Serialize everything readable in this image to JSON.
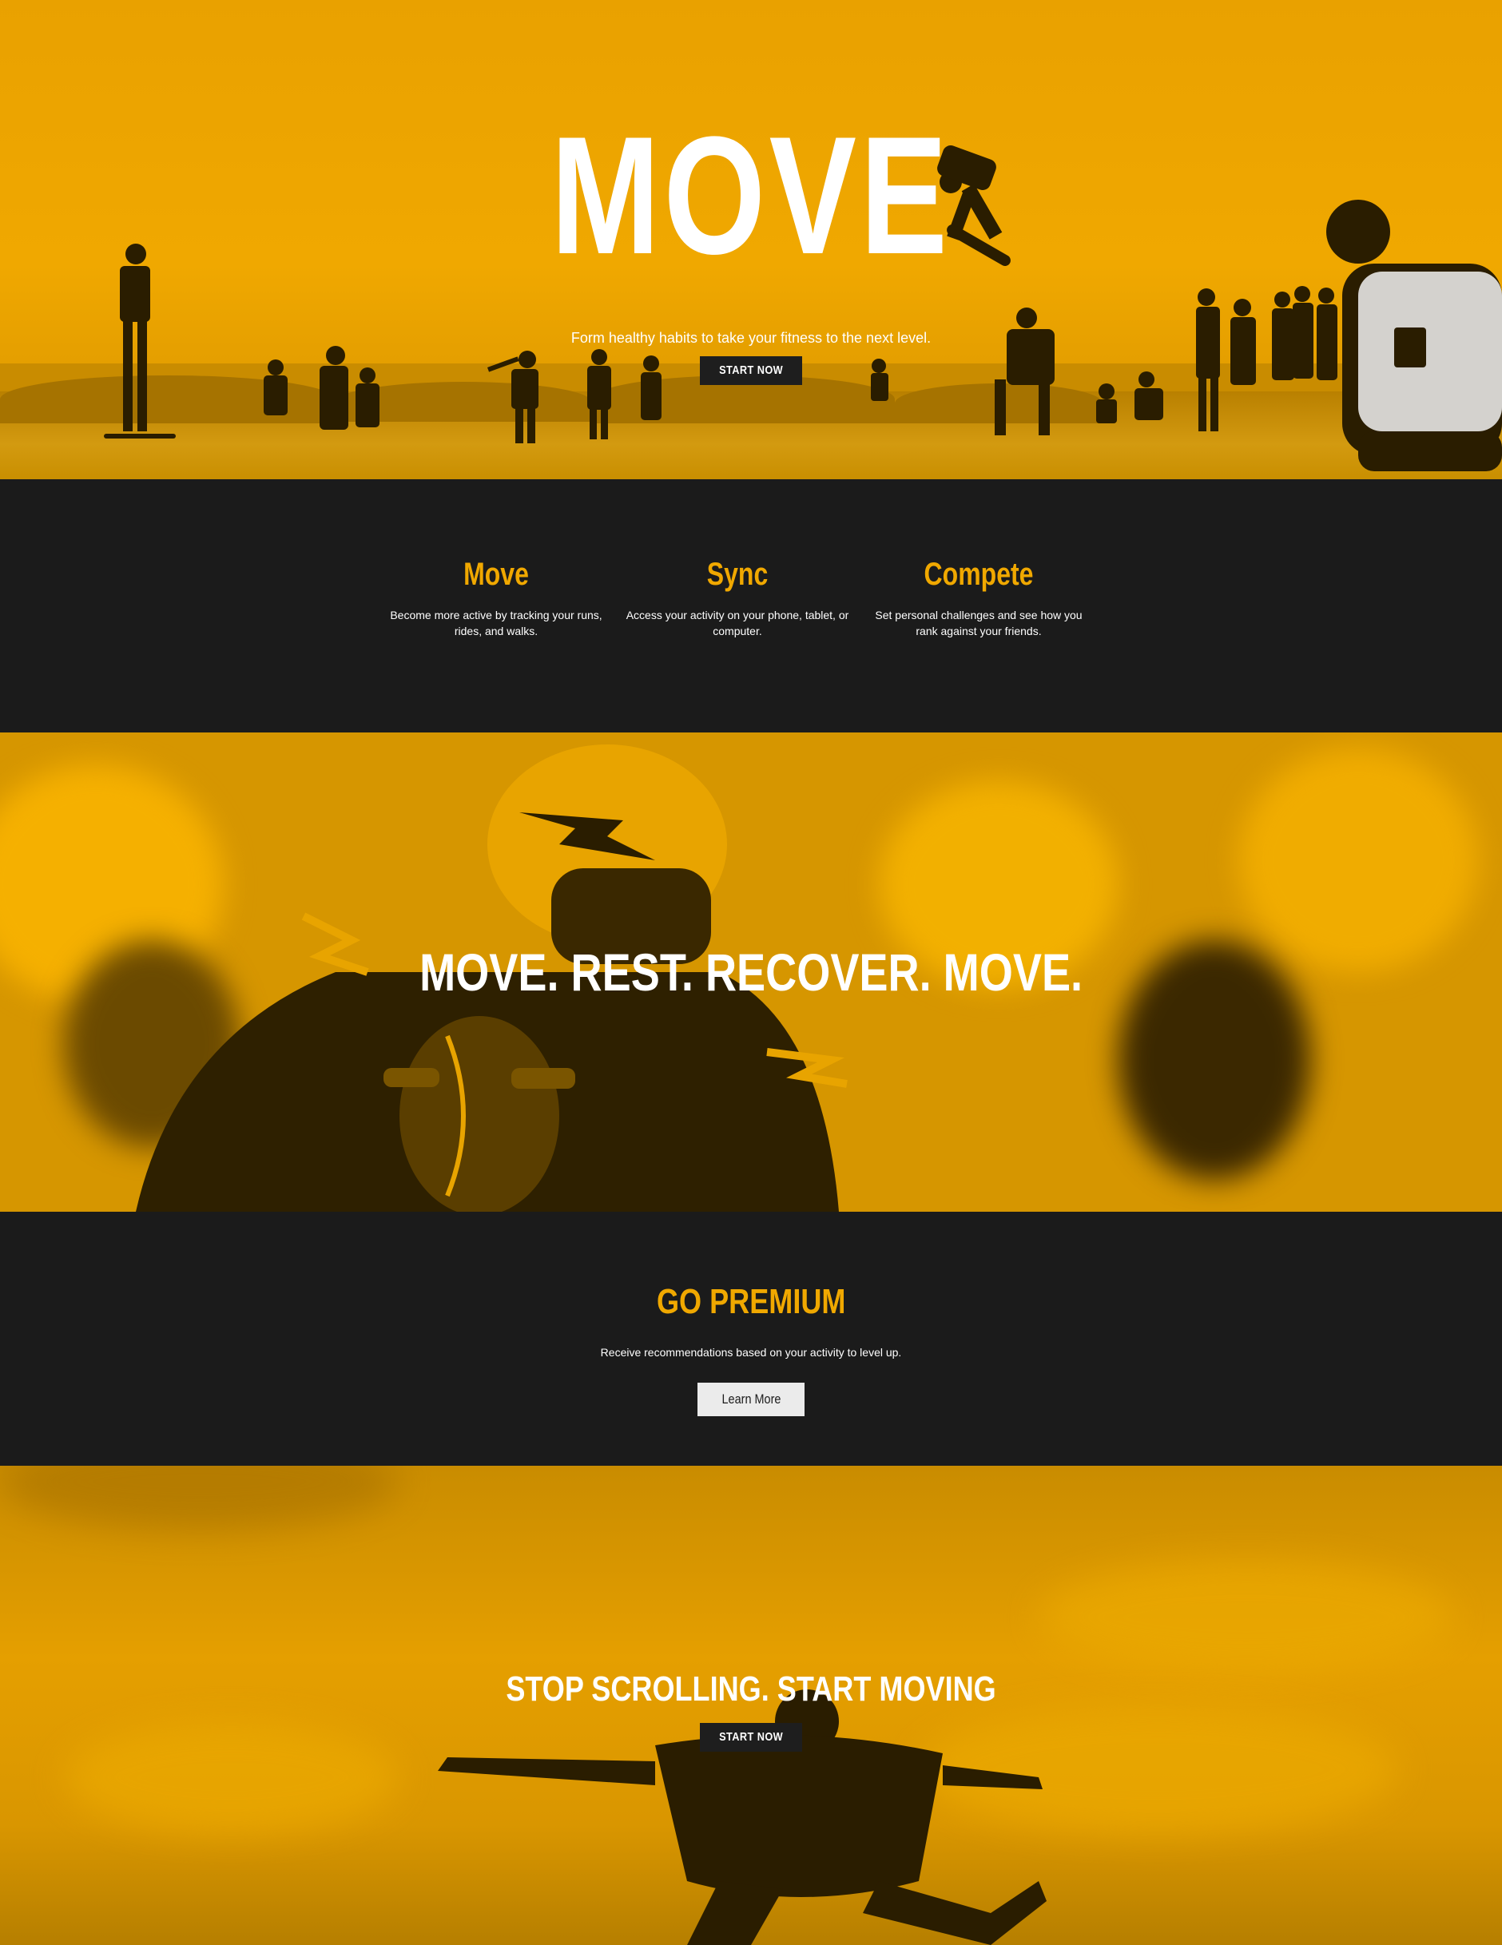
{
  "hero": {
    "title": "MOVE",
    "subtitle": "Form healthy habits to take your fitness to the next level.",
    "cta_label": "START NOW"
  },
  "features": [
    {
      "title": "Move",
      "text": "Become more active by tracking your runs, rides, and walks."
    },
    {
      "title": "Sync",
      "text": "Access your activity on your phone, tablet, or computer."
    },
    {
      "title": "Compete",
      "text": "Set personal challenges and see how you rank against your friends."
    }
  ],
  "banner": {
    "title": "MOVE. REST. RECOVER. MOVE."
  },
  "premium": {
    "title": "GO PREMIUM",
    "text": "Receive recommendations based on your activity to level up.",
    "cta_label": "Learn More"
  },
  "closing": {
    "title": "STOP SCROLLING. START MOVING",
    "cta_label": "START NOW"
  },
  "colors": {
    "accent": "#f0a800",
    "dark": "#1b1b1b",
    "button_dark": "#1e1e1e",
    "button_light": "#ebebeb"
  }
}
